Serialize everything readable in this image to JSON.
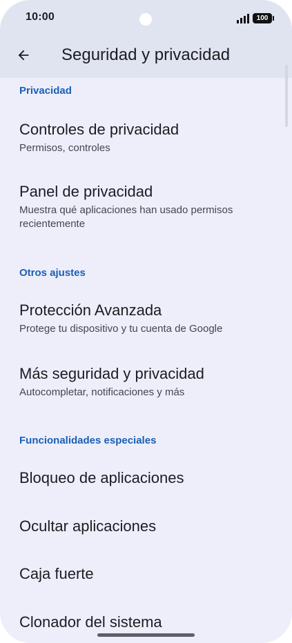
{
  "status_bar": {
    "time": "10:00",
    "battery": "100",
    "icons": [
      "signal-icon",
      "battery-icon"
    ]
  },
  "app_bar": {
    "back_icon": "arrow-back-icon",
    "title": "Seguridad y privacidad"
  },
  "sections": {
    "privacy": {
      "header": "Privacidad",
      "items": [
        {
          "title": "Controles de privacidad",
          "subtitle": "Permisos, controles"
        },
        {
          "title": "Panel de privacidad",
          "subtitle": "Muestra qué aplicaciones han usado permisos recientemente"
        }
      ]
    },
    "other": {
      "header": "Otros ajustes",
      "items": [
        {
          "title": "Protección Avanzada",
          "subtitle": "Protege tu dispositivo y tu cuenta de Google"
        },
        {
          "title": "Más seguridad y privacidad",
          "subtitle": "Autocompletar, notificaciones y más"
        }
      ]
    },
    "special": {
      "header": "Funcionalidades especiales",
      "items": [
        {
          "title": "Bloqueo de aplicaciones"
        },
        {
          "title": "Ocultar aplicaciones"
        },
        {
          "title": "Caja fuerte"
        },
        {
          "title": "Clonador del sistema"
        }
      ]
    }
  },
  "colors": {
    "background": "#eeeefb",
    "app_bar": "#dfe4f0",
    "accent": "#1a5fb4",
    "text": "#1c1b22",
    "subtext": "#45454f"
  }
}
